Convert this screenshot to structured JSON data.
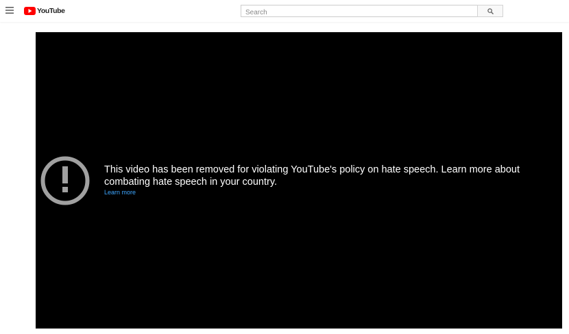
{
  "masthead": {
    "menu_icon": "hamburger-menu-icon",
    "logo_text": "YouTube",
    "logo_color": "#ff0000",
    "search_placeholder": "Search",
    "search_value": "",
    "search_icon": "magnifier-icon"
  },
  "player": {
    "background": "#000000",
    "error_icon": "exclamation-circle-icon",
    "error_message": "This video has been removed for violating YouTube's policy on hate speech. Learn more about combating hate speech in your country.",
    "learn_more_label": "Learn more",
    "link_color": "#3ea6ff"
  }
}
